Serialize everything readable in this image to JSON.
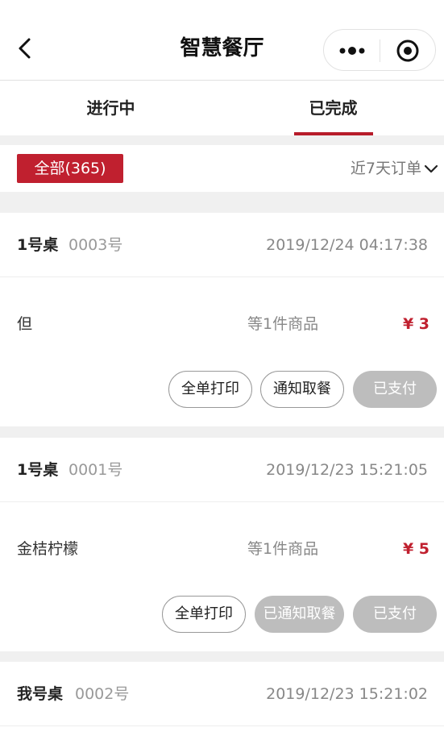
{
  "header": {
    "title": "智慧餐厅"
  },
  "tabs": [
    {
      "label": "进行中"
    },
    {
      "label": "已完成"
    }
  ],
  "filter": {
    "all_label": "全部(365)",
    "range_label": "近7天订单"
  },
  "orders": [
    {
      "table": "1号桌",
      "number": "0003号",
      "time": "2019/12/24 04:17:38",
      "item": "但",
      "count": "等1件商品",
      "price": "¥ 3",
      "buttons": {
        "print": "全单打印",
        "notify": "通知取餐",
        "paid": "已支付"
      }
    },
    {
      "table": "1号桌",
      "number": "0001号",
      "time": "2019/12/23 15:21:05",
      "item": "金桔柠檬",
      "count": "等1件商品",
      "price": "¥ 5",
      "buttons": {
        "print": "全单打印",
        "notify": "已通知取餐",
        "paid": "已支付"
      }
    },
    {
      "table": "我号桌",
      "number": "0002号",
      "time": "2019/12/23 15:21:02"
    }
  ],
  "colors": {
    "accent": "#c0202f",
    "disabled": "#bdbdbd"
  }
}
